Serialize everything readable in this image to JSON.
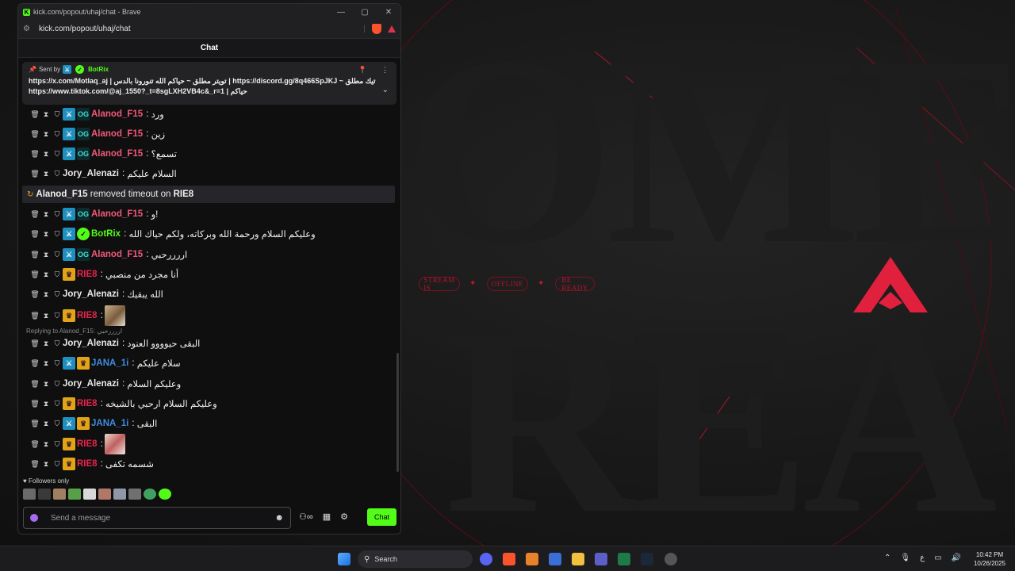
{
  "background": {
    "big_word_top": "OME",
    "big_word_bottom": "REA",
    "banner_items": [
      "STREAM IS",
      "OFFLINE",
      "BE READY"
    ]
  },
  "window": {
    "title": "kick.com/popout/uhaj/chat - Brave",
    "url": "kick.com/popout/uhaj/chat",
    "min": "—",
    "max": "▢",
    "close": "✕"
  },
  "chat": {
    "header": "Chat",
    "pinned": {
      "sent_by": "Sent by",
      "bot_name": "BotRix",
      "line1": "https://x.com/Motlaq_aj | تويتر مطلق ~ حياكم الله تنورونا بالدس | https://discord.gg/8q466SpJKJ ~ تيك مطلق",
      "line2": "https://www.tiktok.com/@aj_1550?_t=8sgLXH2VB4c&_r=1 | حياكم"
    },
    "messages": [
      {
        "user": "Alanod_F15",
        "text": "ورد",
        "color": "pink"
      },
      {
        "user": "Alanod_F15",
        "text": "زين",
        "color": "pink"
      },
      {
        "user": "Alanod_F15",
        "text": "تسمع؟",
        "color": "pink"
      },
      {
        "user": "Jory_Alenazi",
        "text": "السلام عليكم",
        "color": "white"
      },
      {
        "system_user": "Alanod_F15",
        "system_text": "removed timeout on",
        "system_target": "RIE8"
      },
      {
        "user": "Alanod_F15",
        "text": "و!",
        "color": "pink"
      },
      {
        "user": "BotRix",
        "text": "وعليكم السلام ورحمة الله وبركاته، ولكم حياك الله",
        "color": "green"
      },
      {
        "user": "Alanod_F15",
        "text": "اررررحبي",
        "color": "pink"
      },
      {
        "user": "RIE8",
        "text": "أنا مجرد من منصبي",
        "color": "red"
      },
      {
        "user": "Jory_Alenazi",
        "text": "الله يبقيك",
        "color": "white"
      },
      {
        "user": "RIE8",
        "text": "",
        "color": "red"
      },
      {
        "reply": "Replying to Alanod_F15: اررررحبي"
      },
      {
        "user": "Jory_Alenazi",
        "text": "البقى حيوووو العنود",
        "color": "white"
      },
      {
        "user": "JANA_1i",
        "text": "سلام عليكم",
        "color": "blue"
      },
      {
        "user": "Jory_Alenazi",
        "text": "وعليكم السلام",
        "color": "white"
      },
      {
        "user": "RIE8",
        "text": "وعليكم السلام ارحبي بالشيخه",
        "color": "red"
      },
      {
        "user": "JANA_1i",
        "text": "البقى",
        "color": "blue"
      },
      {
        "user": "RIE8",
        "text": "",
        "color": "red"
      },
      {
        "user": "RIE8",
        "text": "شسمه تكفى",
        "color": "red"
      }
    ],
    "followers_only": "Followers only",
    "input_placeholder": "Send a message",
    "send_label": "Chat"
  },
  "taskbar": {
    "search_label": "Search",
    "lang": "ع",
    "time": "10:42 PM",
    "date": "10/26/2025"
  },
  "colors": {
    "kick_green": "#53fc18",
    "accent_red": "#e5244a"
  }
}
